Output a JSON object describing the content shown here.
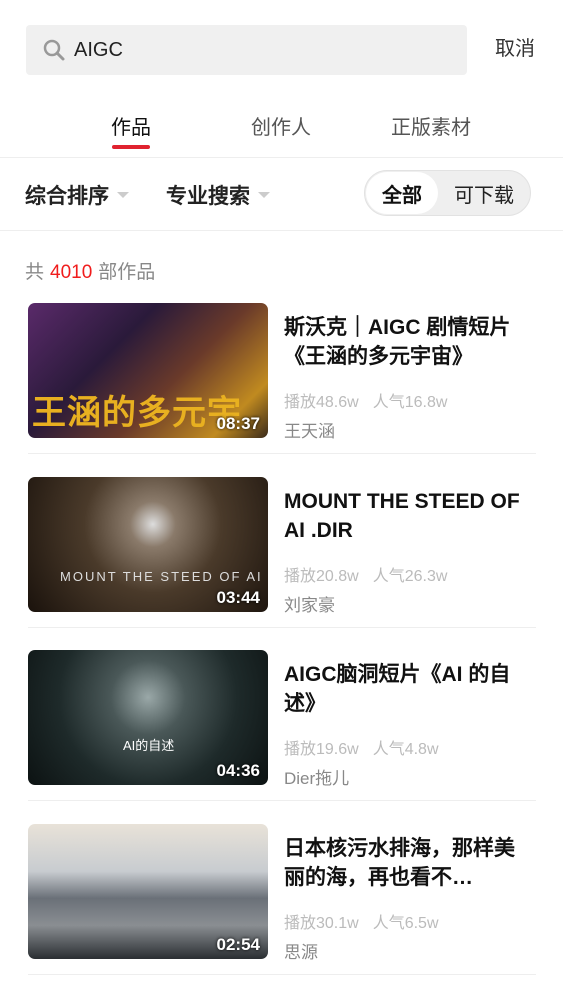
{
  "search": {
    "value": "AIGC",
    "icon": "search-icon"
  },
  "cancel_label": "取消",
  "tabs": [
    {
      "label": "作品"
    },
    {
      "label": "创作人"
    },
    {
      "label": "正版素材"
    }
  ],
  "filters": {
    "sort": "综合排序",
    "pro": "专业搜索",
    "all": "全部",
    "downloadable": "可下载"
  },
  "count": {
    "prefix": "共",
    "value": "4010",
    "suffix": "部作品"
  },
  "accent": "#e0222f",
  "items": [
    {
      "title": "斯沃克｜AIGC 剧情短片《王涵的多元宇宙》",
      "plays": "播放48.6w",
      "pop": "人气16.8w",
      "author": "王天涵",
      "duration": "08:37"
    },
    {
      "title": "MOUNT THE STEED OF AI .DIR",
      "plays": "播放20.8w",
      "pop": "人气26.3w",
      "author": "刘家豪",
      "duration": "03:44"
    },
    {
      "title": "AIGC脑洞短片《AI 的自述》",
      "plays": "播放19.6w",
      "pop": "人气4.8w",
      "author": "Dier拖儿",
      "duration": "04:36"
    },
    {
      "title": "日本核污水排海，那样美丽的海，再也看不…",
      "plays": "播放30.1w",
      "pop": "人气6.5w",
      "author": "思源",
      "duration": "02:54"
    }
  ]
}
